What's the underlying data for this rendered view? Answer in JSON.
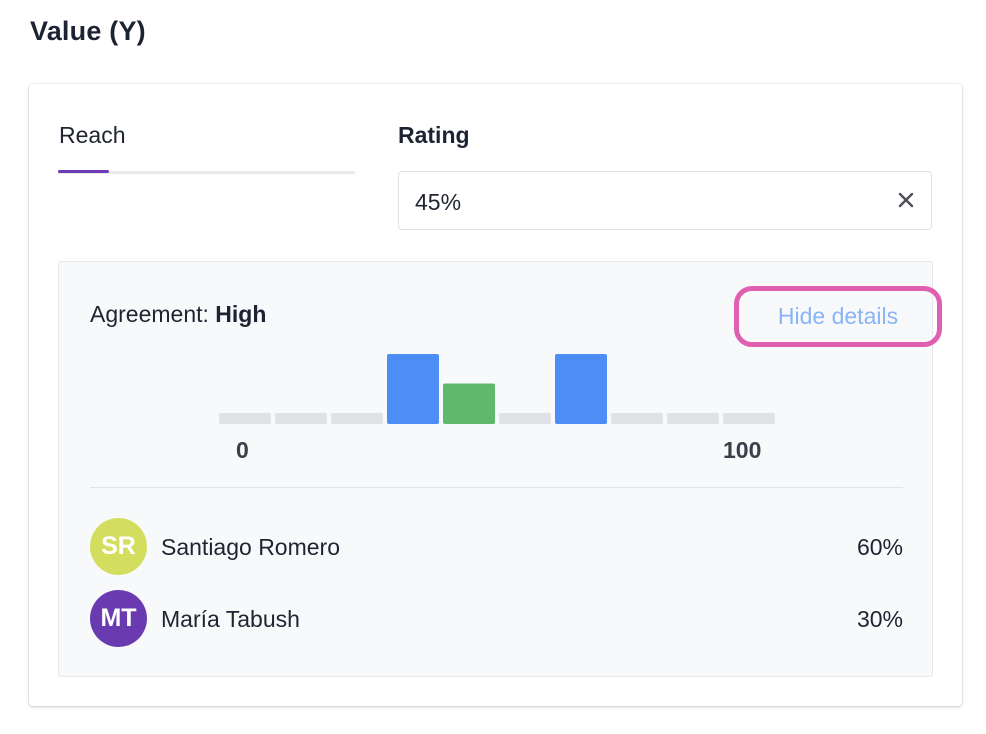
{
  "section": {
    "title": "Value (Y)"
  },
  "tabs": [
    {
      "label": "Reach",
      "active": true
    }
  ],
  "rating": {
    "label": "Rating",
    "value": "45%",
    "clear_icon": "close-icon"
  },
  "details": {
    "agreement_prefix": "Agreement: ",
    "agreement_level": "High",
    "hide_details_label": "Hide details"
  },
  "chart_data": {
    "type": "bar",
    "bins": 10,
    "x_range": [
      0,
      100
    ],
    "tick_labels": [
      "0",
      "100"
    ],
    "values": [
      0,
      0,
      0,
      2,
      1,
      0,
      2,
      0,
      0,
      0
    ],
    "bar_colors": [
      "#e1e2e6",
      "#e1e2e6",
      "#e1e2e6",
      "#4c8df6",
      "#5fb96c",
      "#e1e2e6",
      "#4c8df6",
      "#e1e2e6",
      "#e1e2e6",
      "#e1e2e6"
    ]
  },
  "people": [
    {
      "initials": "SR",
      "name": "Santiago Romero",
      "value": "60%",
      "avatar_color": "#d3de5f"
    },
    {
      "initials": "MT",
      "name": "María Tabush",
      "value": "30%",
      "avatar_color": "#6a3bb0"
    }
  ]
}
